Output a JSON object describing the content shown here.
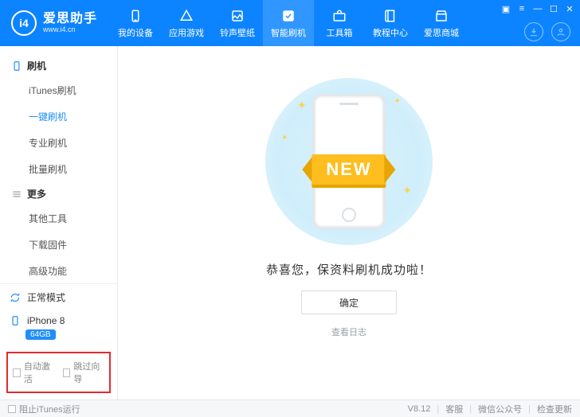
{
  "brand": {
    "name": "爱思助手",
    "site": "www.i4.cn",
    "logo_letters": "i4"
  },
  "nav": [
    {
      "label": "我的设备"
    },
    {
      "label": "应用游戏"
    },
    {
      "label": "铃声壁纸"
    },
    {
      "label": "智能刷机"
    },
    {
      "label": "工具箱"
    },
    {
      "label": "教程中心"
    },
    {
      "label": "爱思商城"
    }
  ],
  "nav_active_index": 3,
  "sidebar": {
    "group1": {
      "title": "刷机",
      "items": [
        "iTunes刷机",
        "一键刷机",
        "专业刷机",
        "批量刷机"
      ],
      "active_index": 1
    },
    "group2": {
      "title": "更多",
      "items": [
        "其他工具",
        "下载固件",
        "高级功能"
      ]
    },
    "mode": "正常模式",
    "device": {
      "name": "iPhone 8",
      "storage": "64GB"
    },
    "checkboxes": {
      "auto_activate": "自动激活",
      "skip_guide": "跳过向导"
    }
  },
  "main": {
    "ribbon": "NEW",
    "success": "恭喜您，保资料刷机成功啦！",
    "ok": "确定",
    "log": "查看日志"
  },
  "footer": {
    "block_itunes": "阻止iTunes运行",
    "version": "V8.12",
    "support": "客服",
    "wechat": "微信公众号",
    "update": "检查更新"
  }
}
